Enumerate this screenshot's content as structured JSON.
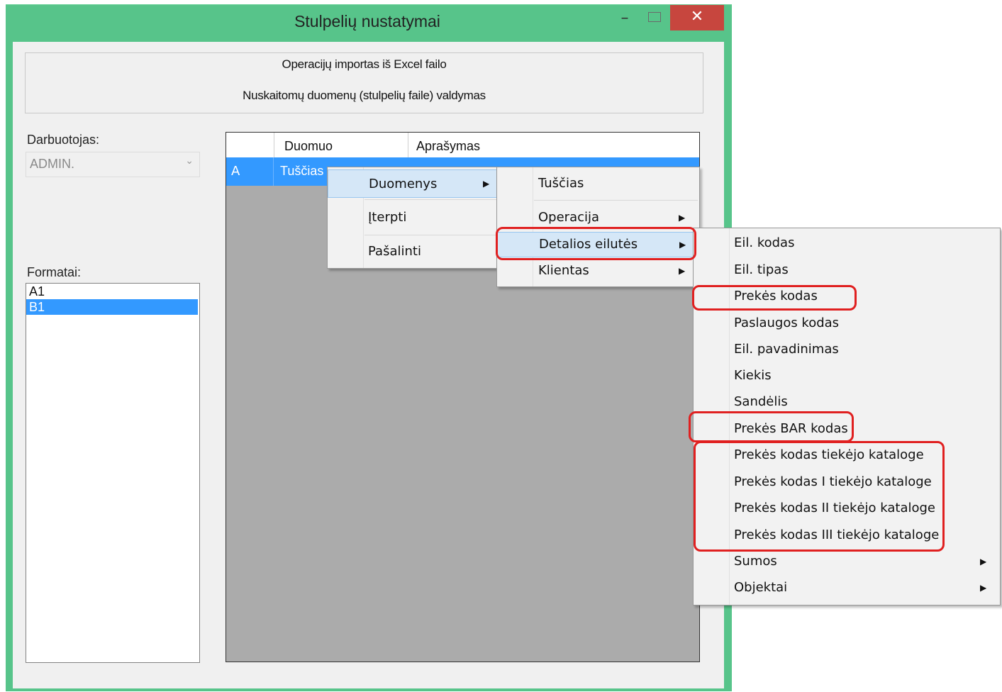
{
  "window": {
    "title": "Stulpelių nustatymai",
    "minimize_symbol": "–",
    "close_symbol": "✕"
  },
  "header": {
    "line1": "Operacijų importas iš Excel failo",
    "line2": "Nuskaitomų duomenų (stulpelių faile) valdymas"
  },
  "employee": {
    "label": "Darbuotojas:",
    "value": "ADMIN."
  },
  "formats": {
    "label": "Formatai:",
    "items": [
      "A1",
      "B1"
    ],
    "selected": "B1"
  },
  "grid": {
    "columns": [
      "Duomuo",
      "Aprašymas"
    ],
    "rows": [
      {
        "header": "A",
        "duomuo": "Tuščias"
      }
    ]
  },
  "menu1": {
    "items": [
      "Duomenys",
      "Įterpti",
      "Pašalinti"
    ],
    "highlighted": "Duomenys"
  },
  "menu2": {
    "items": [
      "Tuščias",
      "Operacija",
      "Detalios eilutės",
      "Klientas"
    ],
    "highlighted": "Detalios eilutės"
  },
  "menu3": {
    "items": [
      "Eil. kodas",
      "Eil. tipas",
      "Prekės kodas",
      "Paslaugos kodas",
      "Eil. pavadinimas",
      "Kiekis",
      "Sandėlis",
      "Prekės BAR kodas",
      "Prekės kodas tiekėjo kataloge",
      "Prekės kodas I tiekėjo kataloge",
      "Prekės kodas II tiekėjo kataloge",
      "Prekės kodas III tiekėjo kataloge",
      "Sumos",
      "Objektai"
    ]
  },
  "colors": {
    "window_frame": "#57c48a",
    "close_button": "#c7463e",
    "selection": "#3399ff",
    "menu_highlight": "#d5e7f7",
    "annotation": "#e02020"
  }
}
